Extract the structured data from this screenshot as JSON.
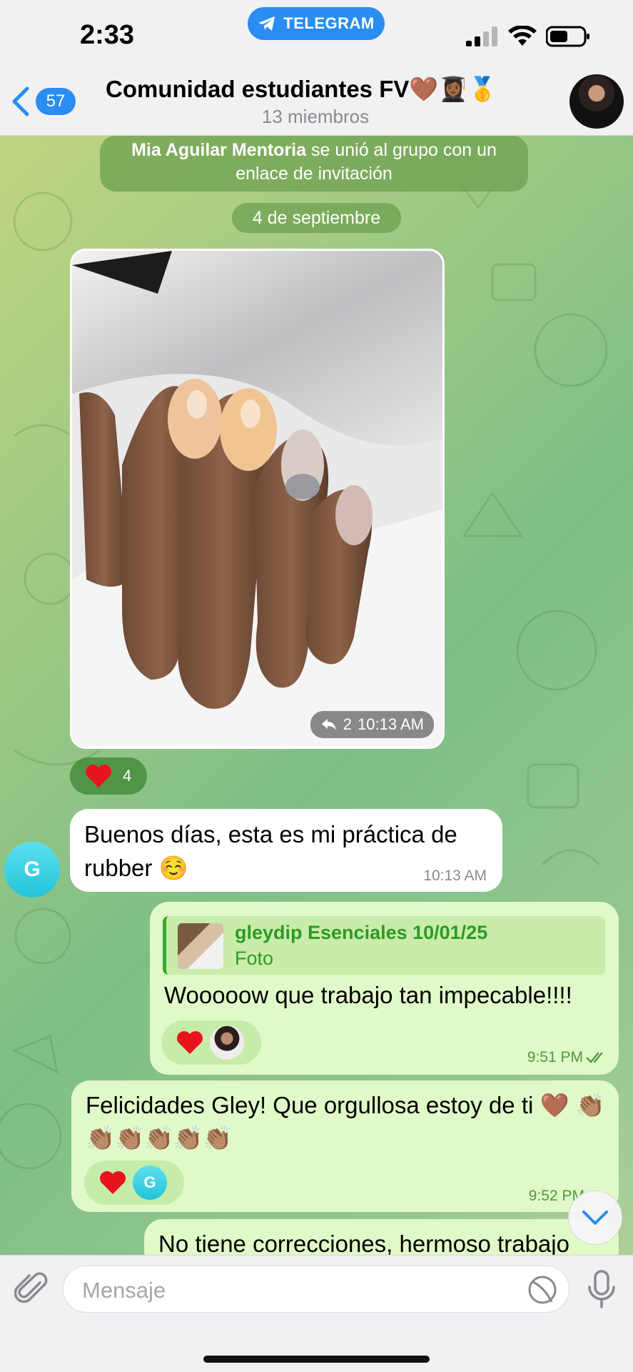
{
  "status_bar": {
    "time": "2:33",
    "source_app": "TELEGRAM",
    "icons": [
      "cellular-signal-icon",
      "wifi-icon",
      "battery-icon"
    ]
  },
  "header": {
    "back_count": "57",
    "title": "Comunidad estudiantes FV🤎👩🏾‍🎓🥇",
    "subtitle": "13 miembros"
  },
  "chat": {
    "service_message": {
      "name": "Mia Aguilar Mentoria",
      "text": " se unió al grupo con un enlace de invitación"
    },
    "date_separator": "4 de septiembre",
    "photo_message": {
      "forward_count": "2",
      "time": "10:13 AM",
      "reaction_count": "4"
    },
    "incoming_message": {
      "sender_initial": "G",
      "text": "Buenos días, esta es mi práctica de rubber ☺️",
      "time": "10:13 AM"
    },
    "outgoing_messages": [
      {
        "reply_title": "gleydip Esenciales 10/01/25",
        "reply_subtitle": "Foto",
        "text": "Wooooow que trabajo tan impecable!!!!",
        "time": "9:51 PM"
      },
      {
        "text": "Felicidades Gley! Que orgullosa estoy de ti 🤎 👏🏽👏🏽👏🏽👏🏽👏🏽👏🏽",
        "reaction_initial": "G",
        "time": "9:52 PM"
      },
      {
        "text": "No tiene correcciones, hermoso trabajo"
      }
    ]
  },
  "composer": {
    "placeholder": "Mensaje"
  },
  "colors": {
    "accent": "#2a8df1",
    "outgoing_bubble": "#e0f9c8",
    "reaction_green": "#3aaa2c",
    "heart": "#e8141c"
  }
}
